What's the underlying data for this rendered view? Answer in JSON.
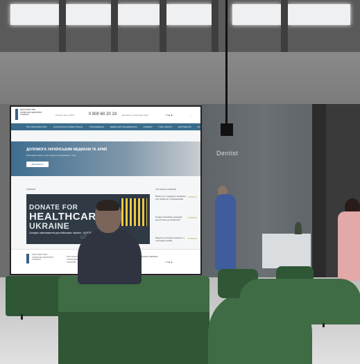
{
  "scene": {
    "sign_text": "Dentist"
  },
  "screen": {
    "logo_text": "МІНІСТЕРСТВО ОХОРОНИ ЗДОРОВ'Я УКРАЇНИ",
    "header_small_1": "Контакт-центр МОЗ",
    "phone": "0 800 60 20 19",
    "header_small_2": "Допомога у виконанні прав",
    "nav": [
      "ПРО МІНІСТЕРСТВО",
      "НАЦІОНАЛЬНА ЕЛЕКТРОННА",
      "ГРОМАДЯНАМ",
      "МЕДИЧНІМ ПРАЦІВНИКАМ",
      "НОВИНИ",
      "ПРЕС-ЦЕНТР",
      "ДОКУМЕНТИ",
      "КОНТАКТИ"
    ],
    "hero_title": "ДОПОМОГА УКРАЇНСЬКИМ МЕДИКАМ ТА АРМІЇ",
    "hero_sub": "Благодійні внески, ліки, медичне обладнання, тощо",
    "hero_button": "ДОПОМОГА",
    "news_heading": "НОВИНИ",
    "side_heading": "АКТУАЛЬНІ НОВИНИ",
    "banner": {
      "line1": "DONATE FOR",
      "line2": "HEALTHCARE",
      "line3": "UKRAINE",
      "line4": "Складіть повноваження для військових України - UNITED24",
      "line5": "u24.gov.ua"
    },
    "side_items": [
      {
        "text": "МОЗ готує стандарти лікування для пацієнтів з пораненнями",
        "tag": "НОВИНА"
      },
      {
        "text": "Понад 3 мільйони українців долучились до вакцинації",
        "tag": "НОВИНА"
      },
      {
        "text": "Медичні установи працюють у штатному режимі",
        "tag": "НОВИНА"
      }
    ],
    "footer": {
      "logo_text": "МІНІСТЕРСТВО ОХОРОНИ ЗДОРОВ'Я УКРАЇНИ",
      "col1": [
        "ПРО МІНІСТЕРСТВО",
        "ГРОМАДЯНАМ",
        "ЛІКАРЯМ"
      ],
      "col2": [
        "НОВИНИ",
        "ДОКУМЕНТИ"
      ],
      "heading": "СОЦІАЛЬНІ МЕРЕЖІ"
    }
  }
}
